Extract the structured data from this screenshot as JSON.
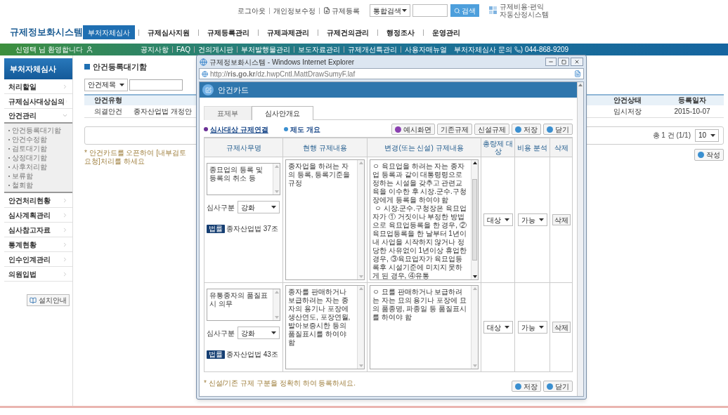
{
  "header": {
    "util_links": [
      {
        "label": "로그아웃",
        "kind": "plain"
      },
      {
        "label": "개인정보수정",
        "kind": "plain"
      },
      {
        "label": "규제등록",
        "kind": "icon"
      }
    ],
    "search": {
      "scope": "통합검색",
      "button": "검색"
    },
    "logo_lines": [
      "규제비용·편익",
      "자동산정시스템"
    ]
  },
  "site_title": "규제정보화시스템",
  "nav": [
    {
      "label": "부처자체심사",
      "selected": true
    },
    {
      "label": "규제심사지원",
      "selected": false
    },
    {
      "label": "규제등록관리",
      "selected": false
    },
    {
      "label": "규제과제관리",
      "selected": false
    },
    {
      "label": "규제건의관리",
      "selected": false
    },
    {
      "label": "행정조사",
      "selected": false
    },
    {
      "label": "운영관리",
      "selected": false
    }
  ],
  "bar": {
    "welcome": "신영택 님 환영합니다",
    "links": [
      "공지사항",
      "FAQ",
      "건의게시판",
      "부처발행물관리",
      "보도자료관리",
      "규제개선특관리",
      "사용자매뉴얼"
    ],
    "contact": "부처자체심사 문의",
    "phone": ") 044-868-9209"
  },
  "sidebar": {
    "title": "부처자체심사",
    "items": [
      {
        "label": "처리할일",
        "expanded": false
      },
      {
        "label": "규제심사대상심의",
        "expanded": false
      },
      {
        "label": "안건관리",
        "expanded": true,
        "children": [
          "안건등록대기함",
          "안건수정함",
          "검토대기함",
          "상정대기함",
          "사후처리함",
          "보류함",
          "철회함"
        ]
      },
      {
        "label": "안건처리현황",
        "expanded": false
      },
      {
        "label": "심사계획관리",
        "expanded": false
      },
      {
        "label": "심사참고자료",
        "expanded": false
      },
      {
        "label": "통계현황",
        "expanded": false
      },
      {
        "label": "인수인계관리",
        "expanded": false
      },
      {
        "label": "의원입법",
        "expanded": false
      }
    ],
    "install_button": "설치안내"
  },
  "main": {
    "title": "안건등록대기함",
    "search_scope": "안건제목",
    "table": {
      "left_columns": [
        {
          "header": "안건유형",
          "cell": "의결안건"
        },
        {
          "cell": "종자산업법 개정안"
        }
      ],
      "right_columns": [
        {
          "header": "안건상태",
          "cell": "임시저장"
        },
        {
          "header": "등록일자",
          "cell": "2015-10-07"
        }
      ]
    },
    "total": "총 1 건 (1/1)",
    "page_size": "10",
    "note": "* 안건카드를 오픈하여 [내부검토요청]처리를 하세요",
    "write_button": "작성"
  },
  "popup": {
    "window_title": "규제정보화시스템 - Windows Internet Explorer",
    "url": "http://**ris.go.kr**/dz.hwpCntl.MattDrawSumyF.laf",
    "card_title": "안건카드",
    "tabs": [
      {
        "label": "표제부",
        "selected": false
      },
      {
        "label": "심사안개요",
        "selected": true
      }
    ],
    "sections": [
      {
        "label": "심사대상 규제연결",
        "selected": true
      },
      {
        "label": "제도 개요",
        "selected": false
      }
    ],
    "toolbar": [
      {
        "label": "예시화면",
        "kind": "accent"
      },
      {
        "label": "기존규제",
        "kind": "plain"
      },
      {
        "label": "신설규제",
        "kind": "plain"
      },
      {
        "label": "저장",
        "kind": "action"
      },
      {
        "label": "닫기",
        "kind": "action"
      }
    ],
    "columns": [
      "규제사무명",
      "현행 규제내용",
      "변경(또는 신설) 규제내용",
      "총량제 대상",
      "비용 분석",
      "삭제"
    ],
    "rows": [
      {
        "name": "종묘업의 등록 및 등록의 취소 등",
        "review_label": "심사구분",
        "review_type": "강화",
        "law_badge": "법률",
        "law": "종자산업법 37조",
        "current": "종자업을 하려는 자의 등록, 등록기준을 규정",
        "changed": "ㅇ 육묘업을 하려는 자는 종자업 등록과 같이 대통령령으로 정하는 시설을 갖추고 관련교육을 이수한 후 시장.군수.구청장에게 등록을 하여야 함\n ㅇ 시장.군수.구청장은 육묘업자가 ① 거짓이나 부정한 방법으로 육묘업등록을 한 경우, ②육묘업등록을 한 날부터 1년이내 사업을 시작하지 않거나 정당한 사유없이 1년이상 휴업한 경우, ③육묘업자가 육묘업등록후 시설기준에 미치지 못하게 된 경우, ④유통",
        "cap": "대상",
        "cost": "가능",
        "delete": "삭제"
      },
      {
        "name": "유통종자의 품질표시 의무",
        "review_label": "심사구분",
        "review_type": "강화",
        "law_badge": "법률",
        "law": "종자산업법 43조",
        "current": "종자를 판매하거나 보급하려는 자는 종자의 용기나 포장에 생산연도, 포장연월, 발아보증시한 등의 품질표시를 하여야 함",
        "changed": "ㅇ 묘를 판매하거나 보급하려는 자는 묘의 용기나 포장에 묘의 품종명, 파종일 등 품질표시를 하여야 함",
        "cap": "대상",
        "cost": "가능",
        "delete": "삭제"
      }
    ],
    "footer_note": "* 신설/기존 규제 구분을 정확히 하여 등록하세요.",
    "footer_buttons": [
      "저장",
      "닫기"
    ]
  }
}
